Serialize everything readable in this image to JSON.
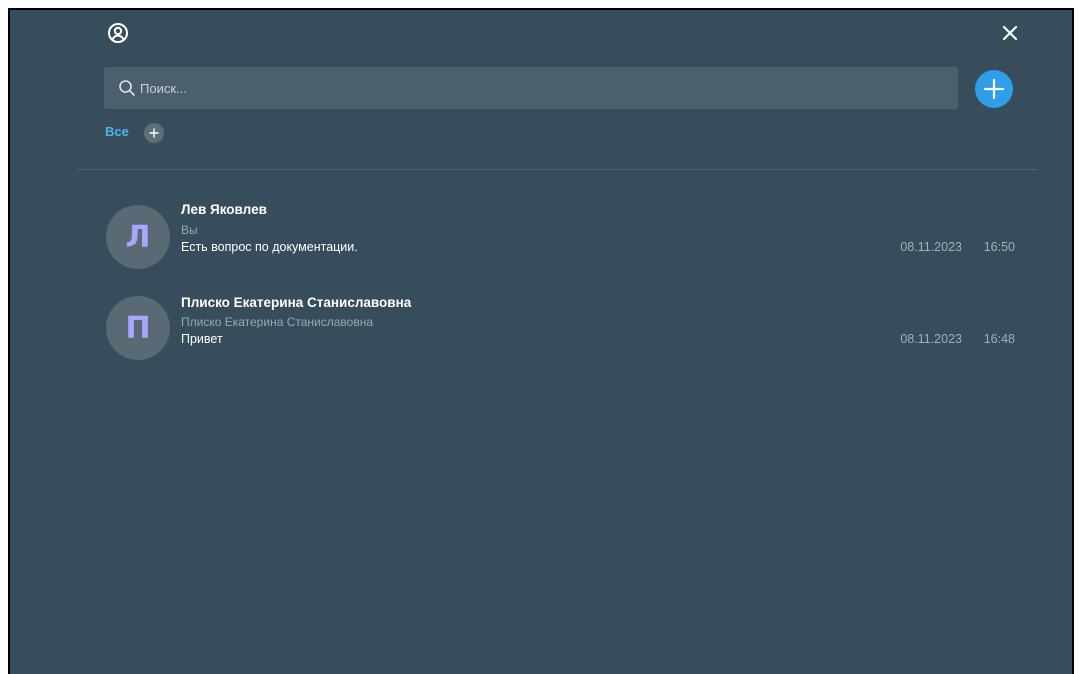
{
  "header": {
    "profile_icon": "user-circle-icon",
    "close_icon": "close-icon"
  },
  "search": {
    "placeholder": "Поиск...",
    "value": "",
    "icon": "search-icon"
  },
  "add_button": {
    "icon": "plus-icon",
    "color": "#2e9ee8"
  },
  "filters": {
    "active_label": "Все",
    "add_icon": "plus-icon"
  },
  "colors": {
    "background": "#374d5b",
    "accent": "#4fb3f0",
    "avatar_letter": "#a9a6ff"
  },
  "chats": [
    {
      "initial": "Л",
      "name": "Лев Яковлев",
      "sender": "Вы",
      "message": "Есть вопрос по документации.",
      "date": "08.11.2023",
      "time": "16:50"
    },
    {
      "initial": "П",
      "name": "Плиско Екатерина Станиславовна",
      "sender": "Плиско Екатерина Станиславовна",
      "message": "Привет",
      "date": "08.11.2023",
      "time": "16:48"
    }
  ]
}
